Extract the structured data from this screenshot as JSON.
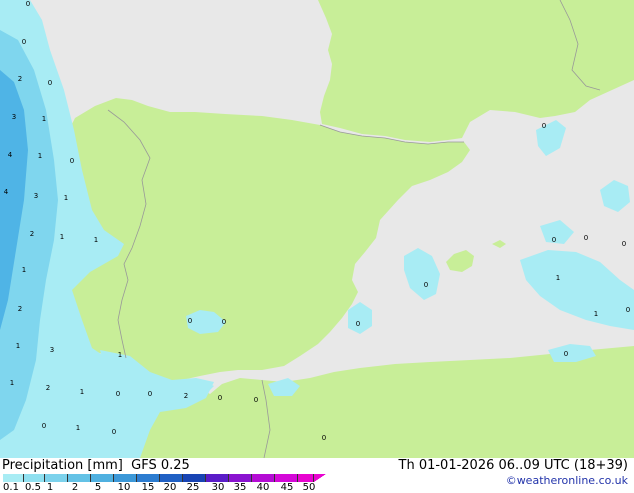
{
  "map": {
    "colors": {
      "sea": "#e8e8e8",
      "land": "#c8ee98",
      "precip_light": "#a8ecf4",
      "precip_mid": "#7fd6ee",
      "precip_heavy": "#4fb4e6",
      "border": "#999999"
    },
    "values": [
      {
        "name": "v1",
        "text": "0"
      },
      {
        "name": "v2",
        "text": "0"
      },
      {
        "name": "v3",
        "text": "2"
      },
      {
        "name": "v4",
        "text": "0"
      },
      {
        "name": "v5",
        "text": "3"
      },
      {
        "name": "v6",
        "text": "1"
      },
      {
        "name": "v7",
        "text": "4"
      },
      {
        "name": "v8",
        "text": "1"
      },
      {
        "name": "v9",
        "text": "0"
      },
      {
        "name": "v10",
        "text": "4"
      },
      {
        "name": "v11",
        "text": "3"
      },
      {
        "name": "v12",
        "text": "1"
      },
      {
        "name": "v13",
        "text": "2"
      },
      {
        "name": "v14",
        "text": "1"
      },
      {
        "name": "v15",
        "text": "1"
      },
      {
        "name": "v16",
        "text": "1"
      },
      {
        "name": "v17",
        "text": "2"
      },
      {
        "name": "v18",
        "text": "1"
      },
      {
        "name": "v19",
        "text": "3"
      },
      {
        "name": "v20",
        "text": "1"
      },
      {
        "name": "v21",
        "text": "1"
      },
      {
        "name": "v22",
        "text": "2"
      },
      {
        "name": "v23",
        "text": "1"
      },
      {
        "name": "v24",
        "text": "0"
      },
      {
        "name": "v25",
        "text": "0"
      },
      {
        "name": "v26",
        "text": "2"
      },
      {
        "name": "v27",
        "text": "0"
      },
      {
        "name": "v28",
        "text": "0"
      },
      {
        "name": "v29",
        "text": "0"
      },
      {
        "name": "v30",
        "text": "1"
      },
      {
        "name": "v31",
        "text": "0"
      },
      {
        "name": "v32",
        "text": "0"
      },
      {
        "name": "v33",
        "text": "0"
      },
      {
        "name": "v34",
        "text": "0"
      },
      {
        "name": "v35",
        "text": "0"
      },
      {
        "name": "v36",
        "text": "0"
      },
      {
        "name": "v37",
        "text": "0"
      },
      {
        "name": "v38",
        "text": "0"
      },
      {
        "name": "v39",
        "text": "0"
      },
      {
        "name": "v40",
        "text": "1"
      },
      {
        "name": "v41",
        "text": "1"
      },
      {
        "name": "v42",
        "text": "0"
      },
      {
        "name": "v43",
        "text": "0"
      },
      {
        "name": "v44",
        "text": "0"
      }
    ]
  },
  "footer": {
    "title": "Precipitation [mm]  GFS 0.25",
    "datetime": "Th 01-01-2026 06..09 UTC (18+39)",
    "credit": "©weatheronline.co.uk",
    "legend": {
      "colors": [
        "#a8ecf4",
        "#90e0f0",
        "#7cd2ec",
        "#64c2e6",
        "#4fb0e0",
        "#3c98d8",
        "#2c7cd0",
        "#2060c4",
        "#1844b4",
        "#5a1cc8",
        "#8a14d0",
        "#b40cd4",
        "#d408d8",
        "#e804d0"
      ],
      "labels": [
        "0.1",
        "0.5",
        "1",
        "2",
        "5",
        "10",
        "15",
        "20",
        "25",
        "30",
        "35",
        "40",
        "45",
        "50"
      ]
    }
  }
}
